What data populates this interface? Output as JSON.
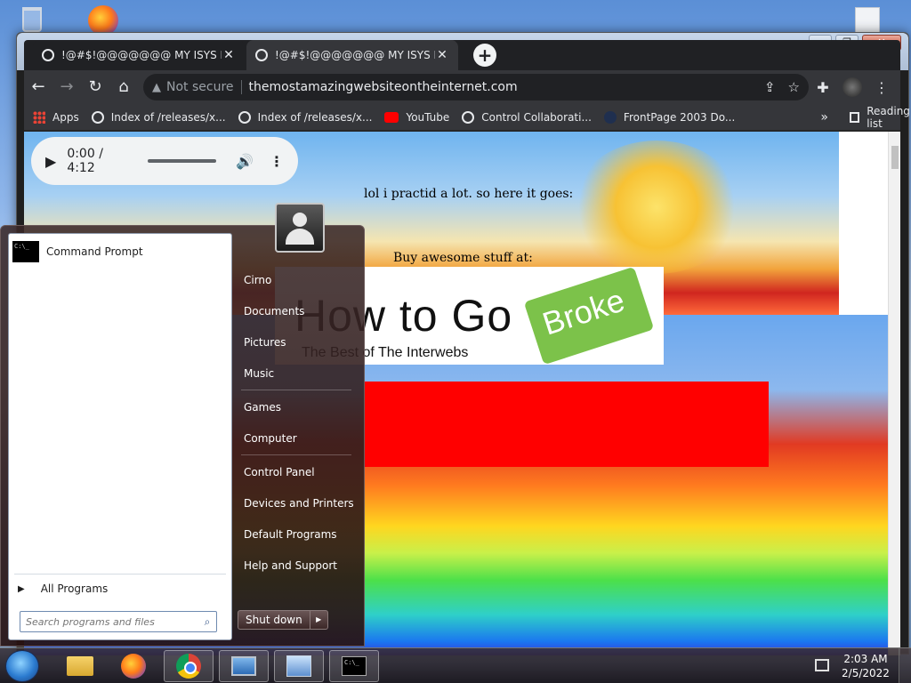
{
  "desktop": {
    "icons": [
      "recycle-bin",
      "firefox",
      "document"
    ]
  },
  "browser": {
    "tabs": [
      {
        "title": "!@#$!@@@@@@@ MY ISYS PR",
        "active": true
      },
      {
        "title": "!@#$!@@@@@@@ MY ISYS PR",
        "active": false
      }
    ],
    "omnibox": {
      "security_label": "Not secure",
      "url": "themostamazingwebsiteontheinternet.com"
    },
    "bookmarks": [
      "Apps",
      "Index of /releases/x...",
      "Index of /releases/x...",
      "YouTube",
      "Control Collaborati...",
      "FrontPage 2003 Do..."
    ],
    "reading_list": "Reading list"
  },
  "page": {
    "audio": {
      "time": "0:00 / 4:12"
    },
    "text1": "lol i practid a lot. so here it goes:",
    "text2": "Buy awesome stuff at:",
    "banner": {
      "title": "How to Go",
      "tag": "Broke",
      "tagline": "The Best of The Interwebs"
    }
  },
  "start_menu": {
    "programs": [
      "Command Prompt"
    ],
    "right_links": [
      "Cirno",
      "Documents",
      "Pictures",
      "Music",
      "Games",
      "Computer",
      "Control Panel",
      "Devices and Printers",
      "Default Programs",
      "Help and Support"
    ],
    "all_programs": "All Programs",
    "search_placeholder": "Search programs and files",
    "shutdown": "Shut down"
  },
  "taskbar": {
    "time": "2:03 AM",
    "date": "2/5/2022"
  }
}
